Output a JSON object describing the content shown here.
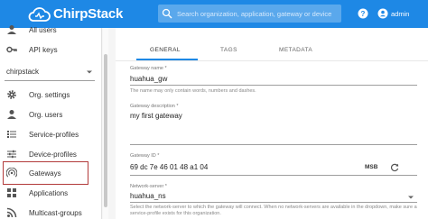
{
  "header": {
    "app_name": "ChirpStack",
    "search_placeholder": "Search organization, application, gateway or device",
    "user_name": "admin"
  },
  "sidebar": {
    "items_top": [
      {
        "label": "All users",
        "icon": "user-icon"
      },
      {
        "label": "API keys",
        "icon": "key-icon"
      }
    ],
    "org_select_value": "chirpstack",
    "items": [
      {
        "label": "Org. settings",
        "icon": "settings-icon"
      },
      {
        "label": "Org. users",
        "icon": "user-icon"
      },
      {
        "label": "Service-profiles",
        "icon": "list-icon"
      },
      {
        "label": "Device-profiles",
        "icon": "sliders-icon"
      },
      {
        "label": "Gateways",
        "icon": "wifi-icon"
      },
      {
        "label": "Applications",
        "icon": "apps-icon"
      },
      {
        "label": "Multicast-groups",
        "icon": "rss-icon"
      }
    ]
  },
  "tabs": [
    {
      "label": "GENERAL",
      "active": true
    },
    {
      "label": "TAGS",
      "active": false
    },
    {
      "label": "METADATA",
      "active": false
    }
  ],
  "form": {
    "gateway_name": {
      "label": "Gateway name *",
      "value": "huahua_gw",
      "help": "The name may only contain words, numbers and dashes."
    },
    "gateway_description": {
      "label": "Gateway description *",
      "value": "my first gateway"
    },
    "gateway_id": {
      "label": "Gateway ID *",
      "value": "69 dc 7e 46 01 48 a1 04",
      "byte_order": "MSB"
    },
    "network_server": {
      "label": "Network-server *",
      "value": "huahua_ns",
      "help": "Select the network-server to which the gateway will connect. When no network-servers are available in the dropdown, make sure a service-profile exists for this organization."
    }
  },
  "colors": {
    "appbar": "#1e88e5",
    "highlight": "#b23a3a"
  }
}
